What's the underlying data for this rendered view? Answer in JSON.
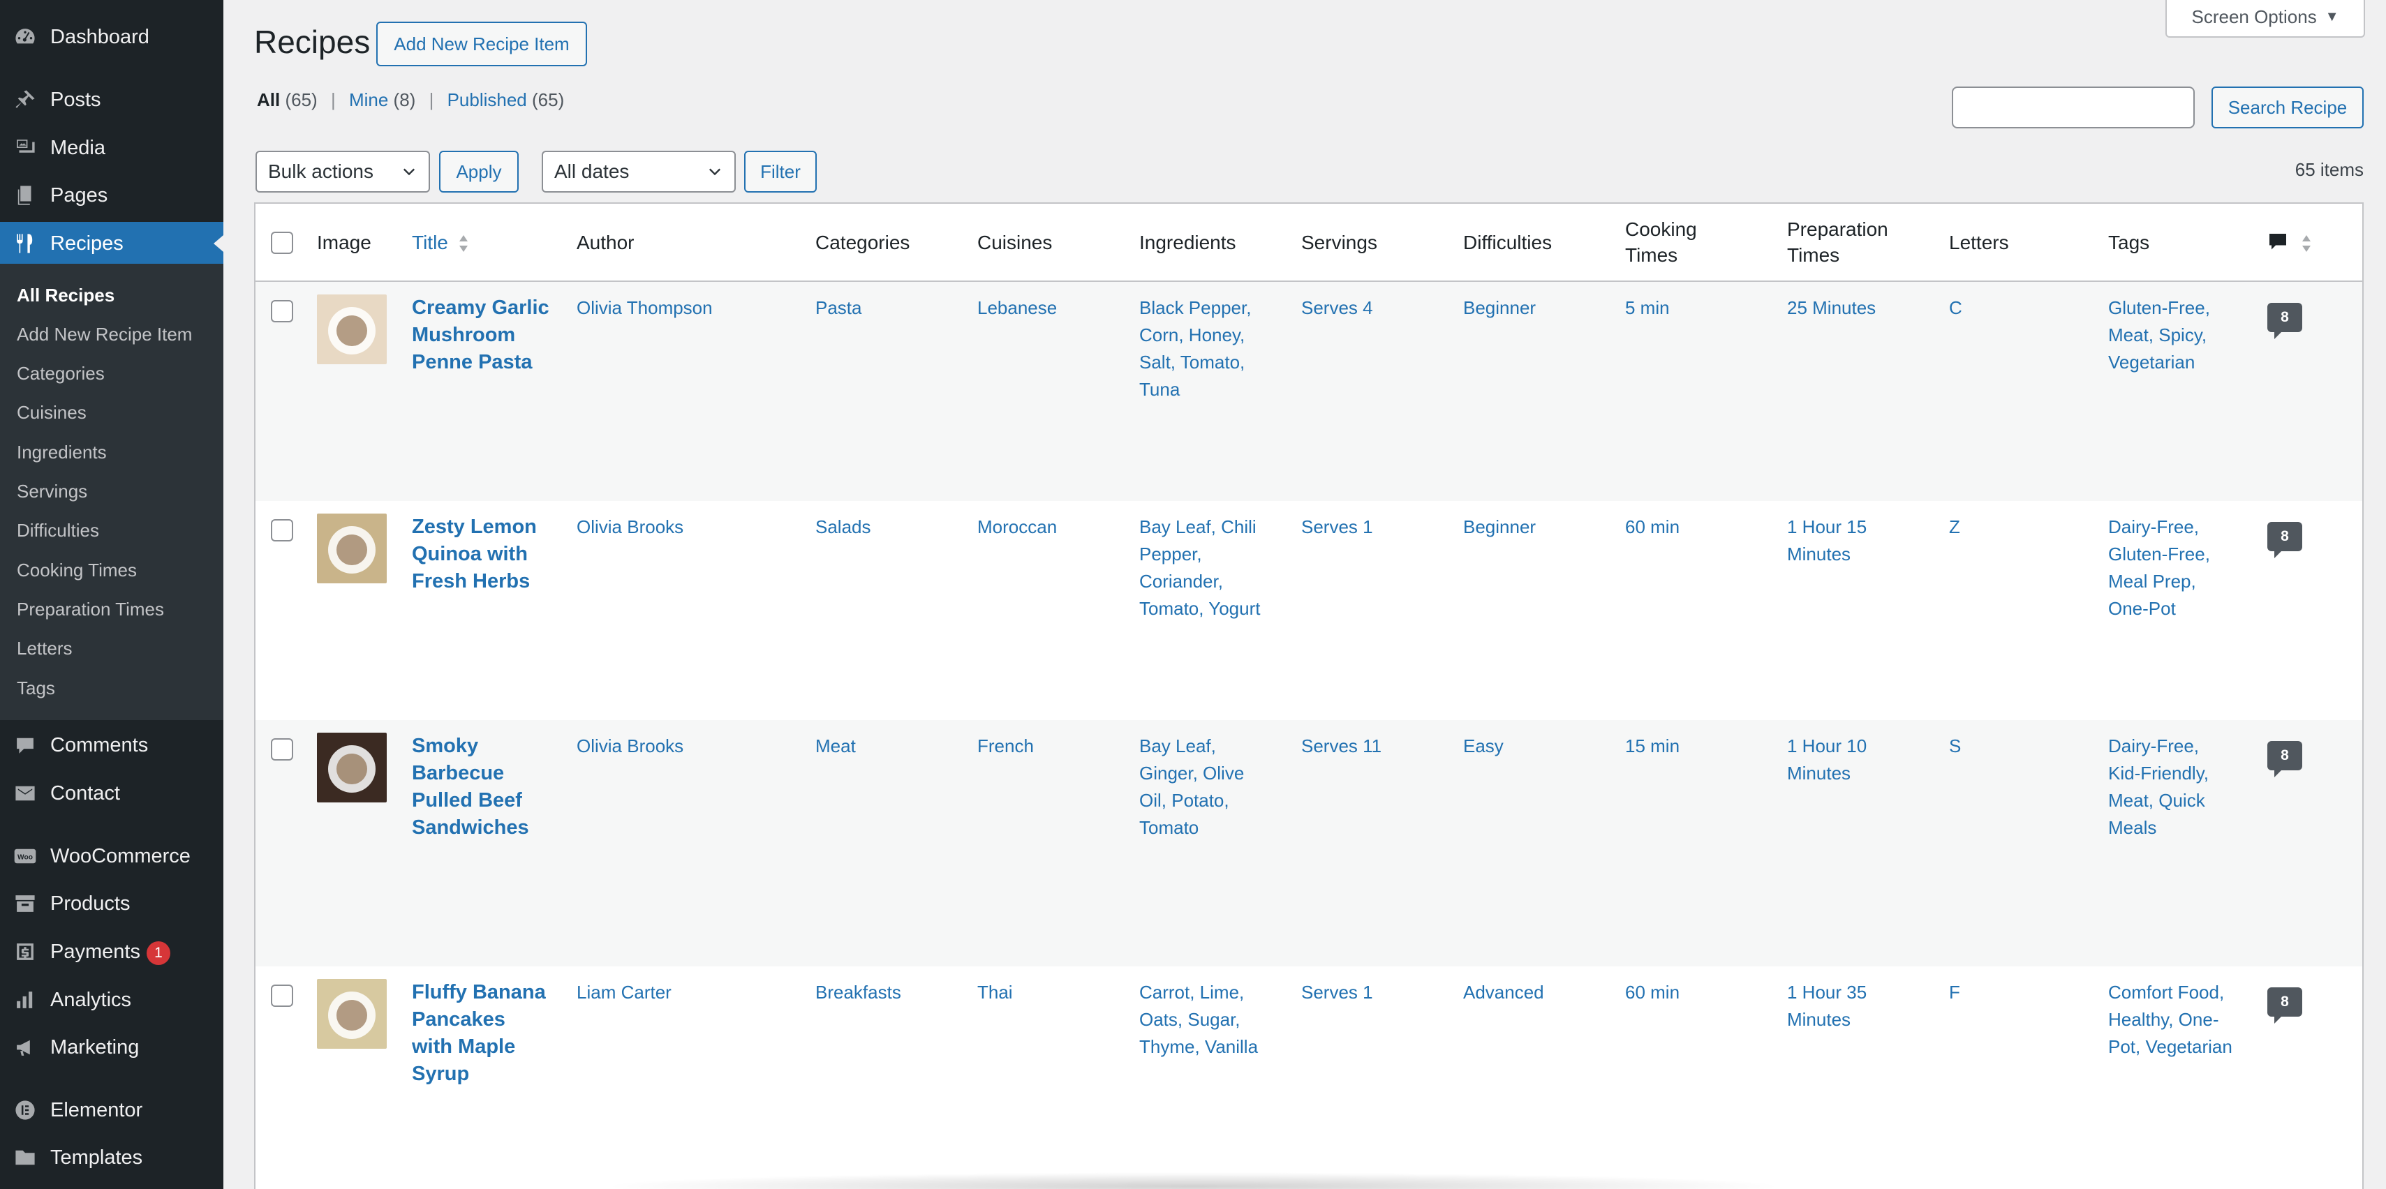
{
  "sidebar": {
    "dashboard": "Dashboard",
    "posts": "Posts",
    "media": "Media",
    "pages": "Pages",
    "recipes": "Recipes",
    "submenu": [
      "All Recipes",
      "Add New Recipe Item",
      "Categories",
      "Cuisines",
      "Ingredients",
      "Servings",
      "Difficulties",
      "Cooking Times",
      "Preparation Times",
      "Letters",
      "Tags"
    ],
    "comments": "Comments",
    "contact": "Contact",
    "woocommerce": "WooCommerce",
    "woo_icon_text": "Woo",
    "products": "Products",
    "payments": "Payments",
    "payments_badge": "1",
    "analytics": "Analytics",
    "marketing": "Marketing",
    "elementor": "Elementor",
    "templates": "Templates"
  },
  "header": {
    "title": "Recipes",
    "add_new": "Add New Recipe Item",
    "screen_options": "Screen Options",
    "views": {
      "all": "All",
      "all_count": "(65)",
      "mine": "Mine",
      "mine_count": "(8)",
      "published": "Published",
      "published_count": "(65)",
      "sep": "|"
    },
    "search_placeholder": "",
    "search_button": "Search Recipe",
    "bulk_actions": "Bulk actions",
    "apply": "Apply",
    "all_dates": "All dates",
    "filter": "Filter",
    "items_count": "65 items"
  },
  "columns": {
    "image": "Image",
    "title": "Title",
    "author": "Author",
    "categories": "Categories",
    "cuisines": "Cuisines",
    "ingredients": "Ingredients",
    "servings": "Servings",
    "difficulties": "Difficulties",
    "cooking_times": [
      "Cooking",
      "Times"
    ],
    "preparation_times": [
      "Preparation",
      "Times"
    ],
    "letters": "Letters",
    "tags": "Tags"
  },
  "rows": [
    {
      "title": [
        "Creamy Garlic",
        "Mushroom",
        "Penne Pasta"
      ],
      "author": "Olivia Thompson",
      "category": "Pasta",
      "cuisine": "Lebanese",
      "ingredients": [
        "Black Pepper,",
        "Corn, Honey,",
        "Salt, Tomato,",
        "Tuna"
      ],
      "servings": "Serves 4",
      "difficulty": "Beginner",
      "cooking_time": "5 min",
      "prep_time": [
        "25 Minutes"
      ],
      "letter": "C",
      "tags": [
        "Gluten-Free,",
        "Meat, Spicy,",
        "Vegetarian"
      ],
      "comments": "8",
      "thumb_color": "#e8d9c4"
    },
    {
      "title": [
        "Zesty Lemon",
        "Quinoa with",
        "Fresh Herbs"
      ],
      "author": "Olivia Brooks",
      "category": "Salads",
      "cuisine": "Moroccan",
      "ingredients": [
        "Bay Leaf, Chili",
        "Pepper,",
        "Coriander,",
        "Tomato, Yogurt"
      ],
      "servings": "Serves 1",
      "difficulty": "Beginner",
      "cooking_time": "60 min",
      "prep_time": [
        "1 Hour 15",
        "Minutes"
      ],
      "letter": "Z",
      "tags": [
        "Dairy-Free,",
        "Gluten-Free,",
        "Meal Prep,",
        "One-Pot"
      ],
      "comments": "8",
      "thumb_color": "#c9b48a"
    },
    {
      "title": [
        "Smoky",
        "Barbecue",
        "Pulled Beef",
        "Sandwiches"
      ],
      "author": "Olivia Brooks",
      "category": "Meat",
      "cuisine": "French",
      "ingredients": [
        "Bay Leaf,",
        "Ginger, Olive",
        "Oil, Potato,",
        "Tomato"
      ],
      "servings": "Serves 11",
      "difficulty": "Easy",
      "cooking_time": "15 min",
      "prep_time": [
        "1 Hour 10",
        "Minutes"
      ],
      "letter": "S",
      "tags": [
        "Dairy-Free,",
        "Kid-Friendly,",
        "Meat, Quick",
        "Meals"
      ],
      "comments": "8",
      "thumb_color": "#3b2a22"
    },
    {
      "title": [
        "Fluffy Banana",
        "Pancakes",
        "with Maple",
        "Syrup"
      ],
      "author": "Liam Carter",
      "category": "Breakfasts",
      "cuisine": "Thai",
      "ingredients": [
        "Carrot, Lime,",
        "Oats, Sugar,",
        "Thyme, Vanilla"
      ],
      "servings": "Serves 1",
      "difficulty": "Advanced",
      "cooking_time": "60 min",
      "prep_time": [
        "1 Hour 35",
        "Minutes"
      ],
      "letter": "F",
      "tags": [
        "Comfort Food,",
        "Healthy, One-",
        "Pot, Vegetarian"
      ],
      "comments": "8",
      "thumb_color": "#d7c9a0"
    }
  ]
}
